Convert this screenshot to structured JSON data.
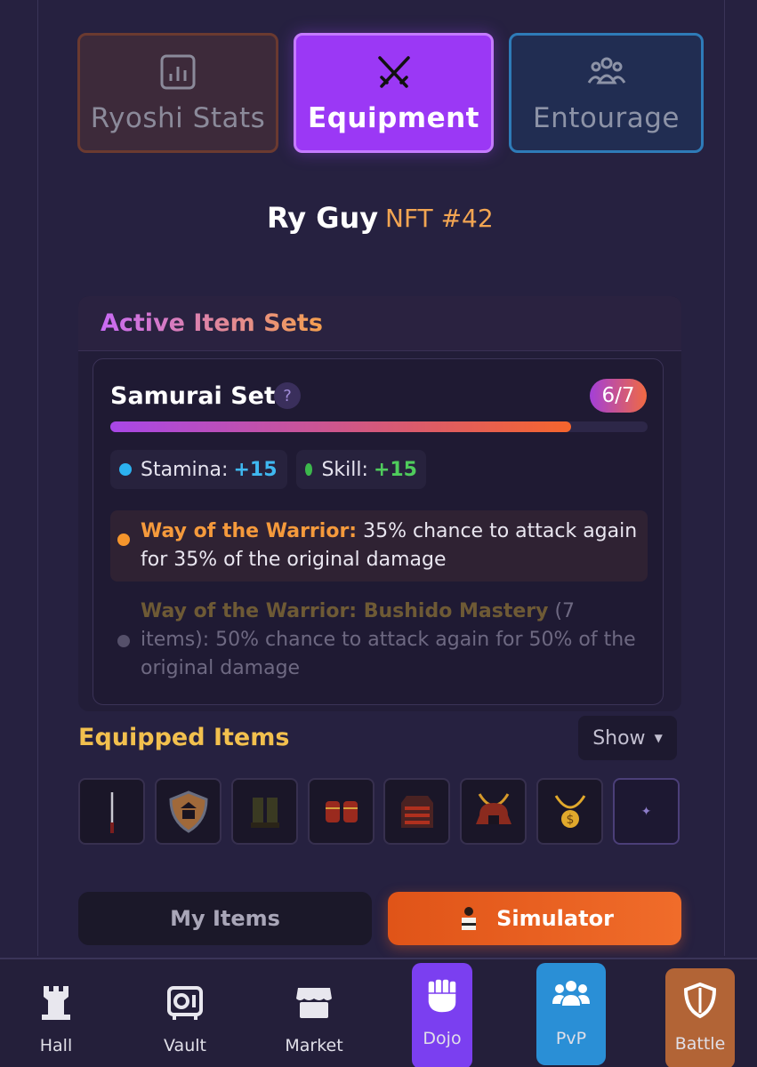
{
  "top_tabs": [
    {
      "label": "Ryoshi Stats",
      "icon": "chart-icon"
    },
    {
      "label": "Equipment",
      "icon": "crossed-swords-icon"
    },
    {
      "label": "Entourage",
      "icon": "group-icon"
    }
  ],
  "character": {
    "name": "Ry Guy",
    "nft": "NFT #42"
  },
  "active_sets": {
    "title": "Active Item Sets",
    "set": {
      "name": "Samurai Set",
      "help": "?",
      "count": "6/7",
      "progress": 0.857,
      "stats": [
        {
          "label": "Stamina:",
          "value": "+15",
          "color": "#3fb8f0"
        },
        {
          "label": "Skill:",
          "value": "+15",
          "color": "#4fcc5c"
        }
      ],
      "bonuses": [
        {
          "name": "Way of the Warrior:",
          "text": " 35% chance to attack again for 35% of the original damage",
          "active": true
        },
        {
          "name": "Way of the Warrior: Bushido Mastery",
          "qualifier": " (7 items)",
          "text": ": 50% chance to attack again for 50% of the original damage",
          "active": false
        }
      ]
    }
  },
  "equipped": {
    "title": "Equipped Items",
    "show_label": "Show",
    "slots": [
      "katana-icon",
      "shield-icon",
      "boots-icon",
      "gauntlets-icon",
      "armor-icon",
      "helmet-icon",
      "gold-chain-icon",
      "empty-slot-icon"
    ],
    "empty_symbol": "✦"
  },
  "toggle": {
    "my_items": "My Items",
    "simulator": "Simulator"
  },
  "nav": [
    {
      "label": "Hall",
      "icon": "tower-icon"
    },
    {
      "label": "Vault",
      "icon": "vault-icon"
    },
    {
      "label": "Market",
      "icon": "market-icon"
    },
    {
      "label": "Dojo",
      "icon": "fist-icon"
    },
    {
      "label": "PvP",
      "icon": "users-icon"
    },
    {
      "label": "Battle",
      "icon": "shield-icon"
    }
  ]
}
